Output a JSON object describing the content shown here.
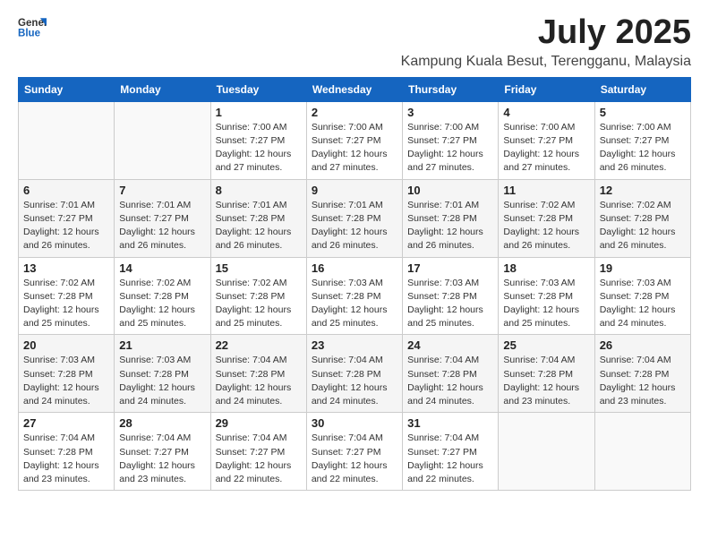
{
  "logo": {
    "line1": "General",
    "line2": "Blue"
  },
  "title": "July 2025",
  "location": "Kampung Kuala Besut, Terengganu, Malaysia",
  "days_of_week": [
    "Sunday",
    "Monday",
    "Tuesday",
    "Wednesday",
    "Thursday",
    "Friday",
    "Saturday"
  ],
  "weeks": [
    [
      {
        "day": "",
        "info": ""
      },
      {
        "day": "",
        "info": ""
      },
      {
        "day": "1",
        "info": "Sunrise: 7:00 AM\nSunset: 7:27 PM\nDaylight: 12 hours\nand 27 minutes."
      },
      {
        "day": "2",
        "info": "Sunrise: 7:00 AM\nSunset: 7:27 PM\nDaylight: 12 hours\nand 27 minutes."
      },
      {
        "day": "3",
        "info": "Sunrise: 7:00 AM\nSunset: 7:27 PM\nDaylight: 12 hours\nand 27 minutes."
      },
      {
        "day": "4",
        "info": "Sunrise: 7:00 AM\nSunset: 7:27 PM\nDaylight: 12 hours\nand 27 minutes."
      },
      {
        "day": "5",
        "info": "Sunrise: 7:00 AM\nSunset: 7:27 PM\nDaylight: 12 hours\nand 26 minutes."
      }
    ],
    [
      {
        "day": "6",
        "info": "Sunrise: 7:01 AM\nSunset: 7:27 PM\nDaylight: 12 hours\nand 26 minutes."
      },
      {
        "day": "7",
        "info": "Sunrise: 7:01 AM\nSunset: 7:27 PM\nDaylight: 12 hours\nand 26 minutes."
      },
      {
        "day": "8",
        "info": "Sunrise: 7:01 AM\nSunset: 7:28 PM\nDaylight: 12 hours\nand 26 minutes."
      },
      {
        "day": "9",
        "info": "Sunrise: 7:01 AM\nSunset: 7:28 PM\nDaylight: 12 hours\nand 26 minutes."
      },
      {
        "day": "10",
        "info": "Sunrise: 7:01 AM\nSunset: 7:28 PM\nDaylight: 12 hours\nand 26 minutes."
      },
      {
        "day": "11",
        "info": "Sunrise: 7:02 AM\nSunset: 7:28 PM\nDaylight: 12 hours\nand 26 minutes."
      },
      {
        "day": "12",
        "info": "Sunrise: 7:02 AM\nSunset: 7:28 PM\nDaylight: 12 hours\nand 26 minutes."
      }
    ],
    [
      {
        "day": "13",
        "info": "Sunrise: 7:02 AM\nSunset: 7:28 PM\nDaylight: 12 hours\nand 25 minutes."
      },
      {
        "day": "14",
        "info": "Sunrise: 7:02 AM\nSunset: 7:28 PM\nDaylight: 12 hours\nand 25 minutes."
      },
      {
        "day": "15",
        "info": "Sunrise: 7:02 AM\nSunset: 7:28 PM\nDaylight: 12 hours\nand 25 minutes."
      },
      {
        "day": "16",
        "info": "Sunrise: 7:03 AM\nSunset: 7:28 PM\nDaylight: 12 hours\nand 25 minutes."
      },
      {
        "day": "17",
        "info": "Sunrise: 7:03 AM\nSunset: 7:28 PM\nDaylight: 12 hours\nand 25 minutes."
      },
      {
        "day": "18",
        "info": "Sunrise: 7:03 AM\nSunset: 7:28 PM\nDaylight: 12 hours\nand 25 minutes."
      },
      {
        "day": "19",
        "info": "Sunrise: 7:03 AM\nSunset: 7:28 PM\nDaylight: 12 hours\nand 24 minutes."
      }
    ],
    [
      {
        "day": "20",
        "info": "Sunrise: 7:03 AM\nSunset: 7:28 PM\nDaylight: 12 hours\nand 24 minutes."
      },
      {
        "day": "21",
        "info": "Sunrise: 7:03 AM\nSunset: 7:28 PM\nDaylight: 12 hours\nand 24 minutes."
      },
      {
        "day": "22",
        "info": "Sunrise: 7:04 AM\nSunset: 7:28 PM\nDaylight: 12 hours\nand 24 minutes."
      },
      {
        "day": "23",
        "info": "Sunrise: 7:04 AM\nSunset: 7:28 PM\nDaylight: 12 hours\nand 24 minutes."
      },
      {
        "day": "24",
        "info": "Sunrise: 7:04 AM\nSunset: 7:28 PM\nDaylight: 12 hours\nand 24 minutes."
      },
      {
        "day": "25",
        "info": "Sunrise: 7:04 AM\nSunset: 7:28 PM\nDaylight: 12 hours\nand 23 minutes."
      },
      {
        "day": "26",
        "info": "Sunrise: 7:04 AM\nSunset: 7:28 PM\nDaylight: 12 hours\nand 23 minutes."
      }
    ],
    [
      {
        "day": "27",
        "info": "Sunrise: 7:04 AM\nSunset: 7:28 PM\nDaylight: 12 hours\nand 23 minutes."
      },
      {
        "day": "28",
        "info": "Sunrise: 7:04 AM\nSunset: 7:27 PM\nDaylight: 12 hours\nand 23 minutes."
      },
      {
        "day": "29",
        "info": "Sunrise: 7:04 AM\nSunset: 7:27 PM\nDaylight: 12 hours\nand 22 minutes."
      },
      {
        "day": "30",
        "info": "Sunrise: 7:04 AM\nSunset: 7:27 PM\nDaylight: 12 hours\nand 22 minutes."
      },
      {
        "day": "31",
        "info": "Sunrise: 7:04 AM\nSunset: 7:27 PM\nDaylight: 12 hours\nand 22 minutes."
      },
      {
        "day": "",
        "info": ""
      },
      {
        "day": "",
        "info": ""
      }
    ]
  ]
}
